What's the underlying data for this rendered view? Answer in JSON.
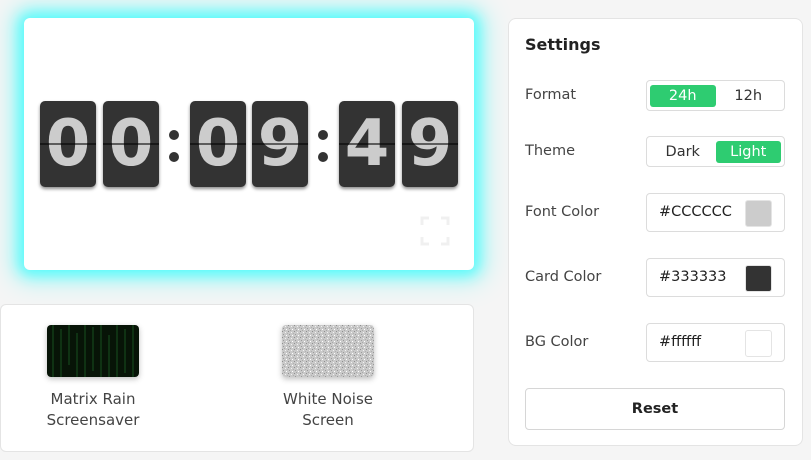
{
  "clock": {
    "digits": [
      "0",
      "0",
      "0",
      "9",
      "4",
      "9"
    ],
    "font_color": "#CCCCCC",
    "card_color": "#333333",
    "bg_color": "#ffffff",
    "glow_color": "#00ffff"
  },
  "related": [
    {
      "line1": "Matrix Rain",
      "line2": "Screensaver",
      "thumb": "matrix-rain-thumbnail"
    },
    {
      "line1": "White Noise",
      "line2": "Screen",
      "thumb": "white-noise-thumbnail"
    }
  ],
  "settings": {
    "title": "Settings",
    "format": {
      "label": "Format",
      "options": [
        "24h",
        "12h"
      ],
      "selected": "24h"
    },
    "theme": {
      "label": "Theme",
      "options": [
        "Dark",
        "Light"
      ],
      "selected": "Light"
    },
    "font_color": {
      "label": "Font Color",
      "value": "#CCCCCC"
    },
    "card_color": {
      "label": "Card Color",
      "value": "#333333"
    },
    "bg_color": {
      "label": "BG Color",
      "value": "#ffffff"
    },
    "reset_label": "Reset",
    "accent": "#2ecc71"
  },
  "icons": {
    "fullscreen": "fullscreen-icon"
  }
}
